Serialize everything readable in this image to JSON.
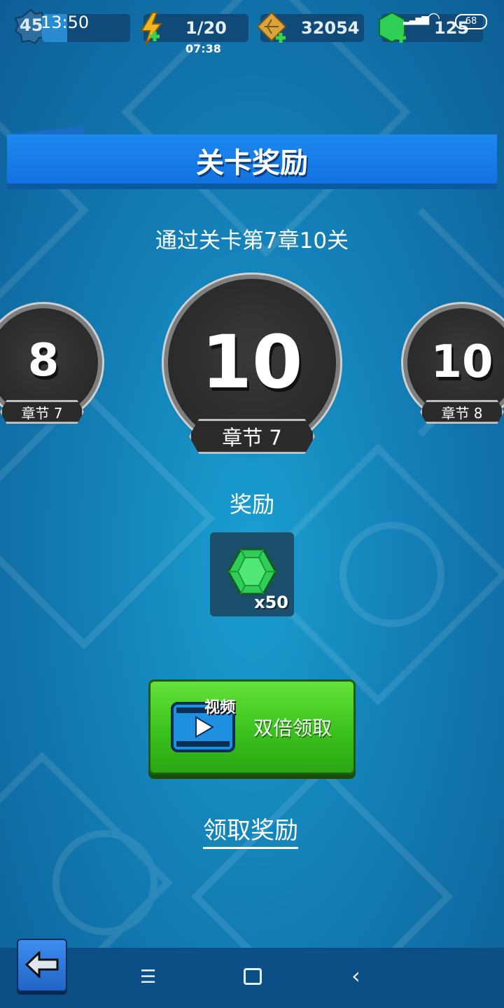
{
  "status_bar": {
    "time": "13:50",
    "battery": "68"
  },
  "hud": {
    "level": "45",
    "energy": "1/20",
    "energy_timer": "07:38",
    "gold": "32054",
    "gems": "125"
  },
  "title": "关卡奖励",
  "subtitle": "通过关卡第7章10关",
  "medals": {
    "left": {
      "number": "8",
      "chapter_label": "章节 7"
    },
    "center": {
      "number": "10",
      "chapter_label": "章节 7"
    },
    "right": {
      "number": "10",
      "chapter_label": "章节 8"
    }
  },
  "reward": {
    "label": "奖励",
    "quantity": "x50",
    "icon": "green-gem-icon"
  },
  "double_button": {
    "badge": "视频",
    "label": "双倍领取",
    "icon": "video-play-icon"
  },
  "claim_link": "领取奖励",
  "nav": {
    "back_icon": "back-arrow-icon",
    "menu_icon": "menu-icon",
    "home_icon": "home-square-icon",
    "back_nav_icon": "chevron-left-icon"
  },
  "colors": {
    "background": "#137fb6",
    "banner": "#1e88f0",
    "button_green": "#3bc21d",
    "gem_green": "#2fcf57"
  }
}
